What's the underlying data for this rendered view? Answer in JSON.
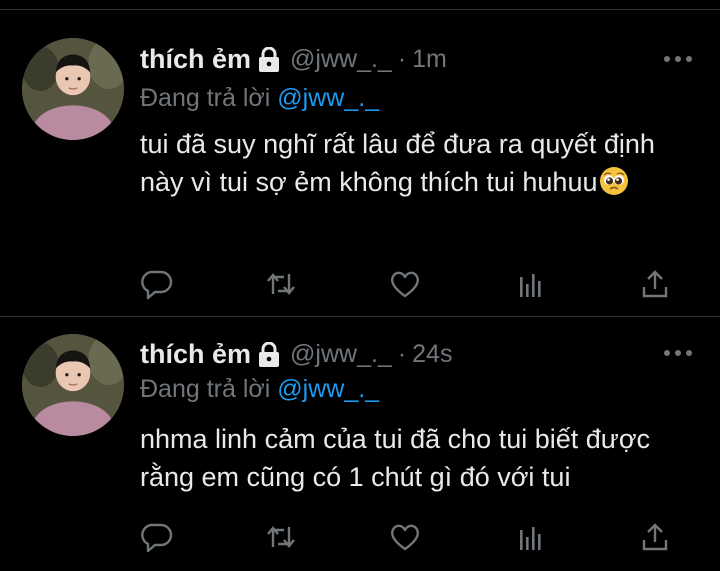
{
  "colors": {
    "background": "#000000",
    "text": "#e7e9ea",
    "secondary": "#71767b",
    "mention": "#1d9bf0",
    "divider": "#2f3336"
  },
  "tweets": [
    {
      "display_name": "thích ẻm",
      "handle": "@jww_._",
      "separator": "·",
      "time": "1m",
      "reply_prefix": "Đang trả lời",
      "reply_mention": "@jww_._",
      "text": "tui đã suy nghĩ rất lâu để đưa ra quyết định này vì tui sợ ẻm không thích tui huhuu",
      "emoji": "pleading-face-emoji"
    },
    {
      "display_name": "thích ẻm",
      "handle": "@jww_._",
      "separator": "·",
      "time": "24s",
      "reply_prefix": "Đang trả lời",
      "reply_mention": "@jww_._",
      "text": "nhma linh cảm của tui đã cho tui biết được rằng em cũng có 1 chút gì đó với tui"
    }
  ],
  "icons": {
    "lock": "lock-icon",
    "more": "more-icon",
    "reply": "reply-icon",
    "retweet": "retweet-icon",
    "like": "heart-icon",
    "analytics": "analytics-icon",
    "share": "share-icon"
  }
}
